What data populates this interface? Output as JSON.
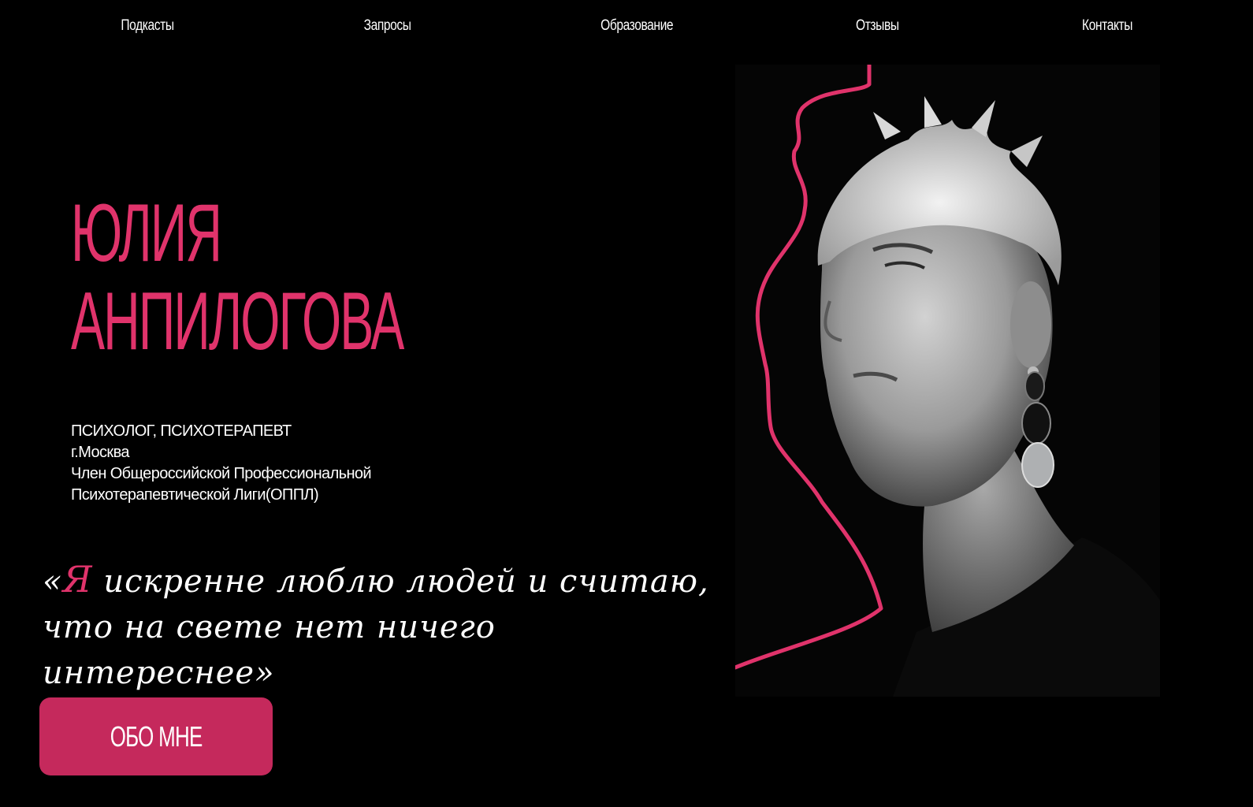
{
  "nav": {
    "items": [
      {
        "label": "Подкасты"
      },
      {
        "label": "Запросы"
      },
      {
        "label": "Образование"
      },
      {
        "label": "Отзывы"
      },
      {
        "label": "Контакты"
      }
    ]
  },
  "hero": {
    "name_line1": "ЮЛИЯ",
    "name_line2": "АНПИЛОГОВА",
    "info": [
      "ПСИХОЛОГ, ПСИХОТЕРАПЕВТ",
      "г.Москва",
      "Член Общероссийской Профессиональной",
      "Психотерапевтической Лиги(ОППЛ)"
    ],
    "quote_open": "«",
    "quote_accent": "Я",
    "quote_text": " искренне люблю людей и считаю, что на свете нет ничего интереснее»",
    "button_label": "ОБО МНЕ"
  },
  "colors": {
    "accent": "#e0336b",
    "button": "#c5295c",
    "background": "#000000"
  },
  "photo": {
    "icon": "portrait-photo"
  }
}
